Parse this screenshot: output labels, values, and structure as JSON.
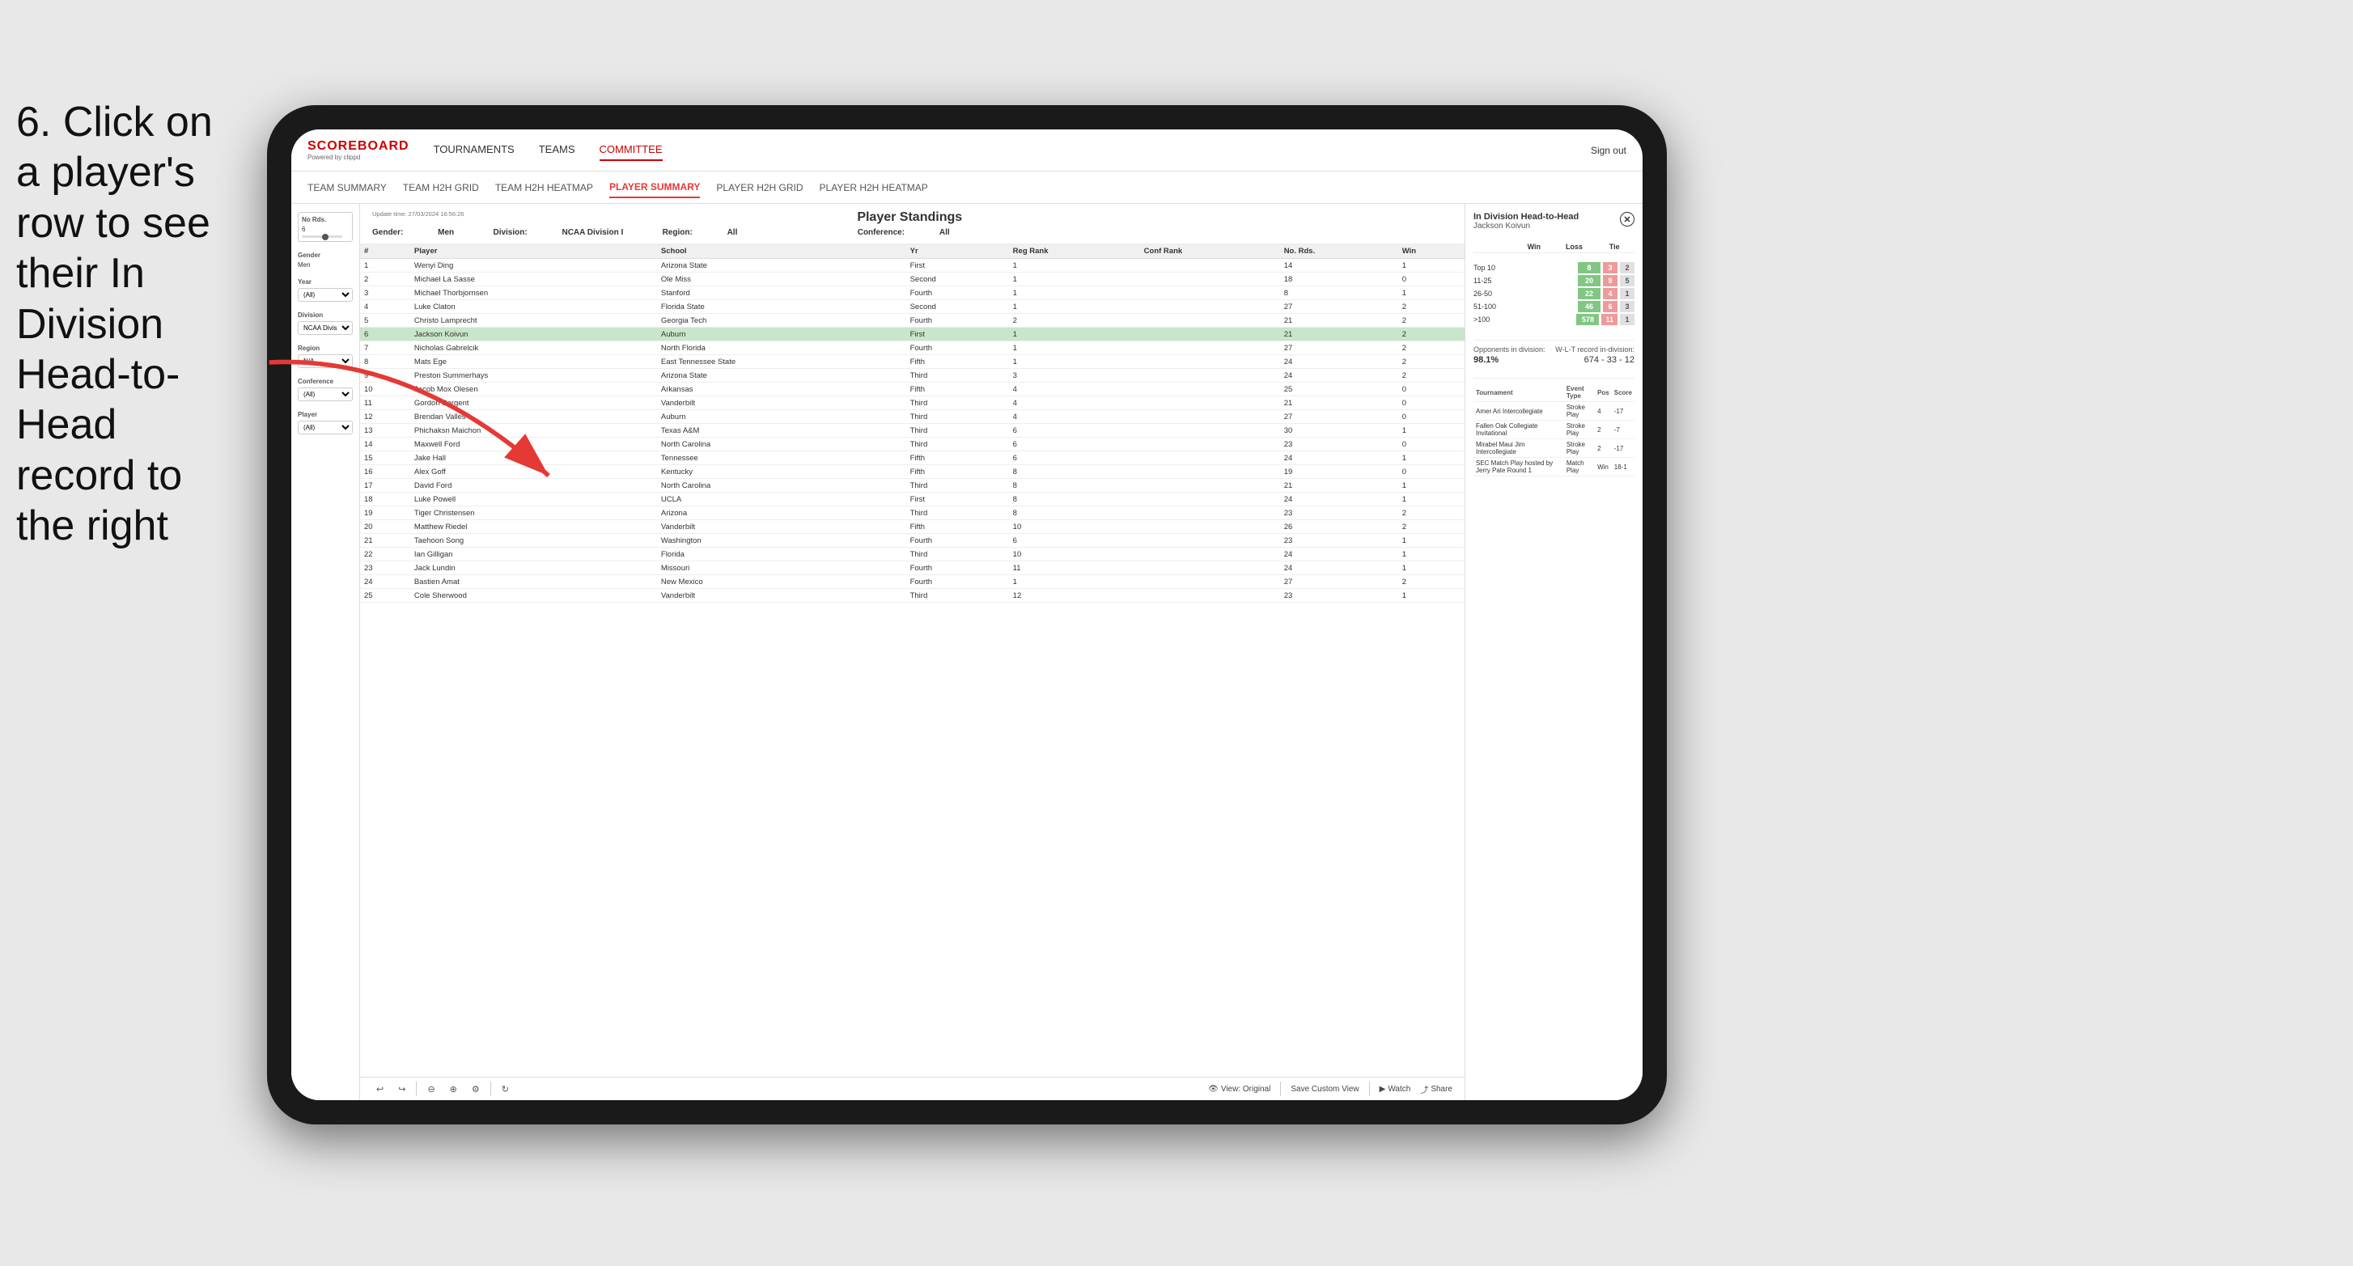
{
  "instruction": {
    "step": "6.",
    "text": "6. Click on a player's row to see their In Division Head-to-Head record to the right"
  },
  "nav": {
    "logo": "SCOREBOARD",
    "logo_sub": "Powered by clippd",
    "links": [
      "TOURNAMENTS",
      "TEAMS",
      "COMMITTEE"
    ],
    "sign_out": "Sign out"
  },
  "secondary_nav": {
    "links": [
      "TEAM SUMMARY",
      "TEAM H2H GRID",
      "TEAM H2H HEATMAP",
      "PLAYER SUMMARY",
      "PLAYER H2H GRID",
      "PLAYER H2H HEATMAP"
    ],
    "active": "PLAYER SUMMARY"
  },
  "filters": {
    "no_rds_label": "No Rds.",
    "no_rds_value": "6",
    "gender_label": "Gender",
    "gender_value": "Men",
    "year_label": "Year",
    "year_value": "(All)",
    "division_label": "Division",
    "division_value": "NCAA Division I",
    "region_label": "Region",
    "region_value": "N/A",
    "conference_label": "Conference",
    "conference_value": "(All)",
    "player_label": "Player",
    "player_value": "(All)"
  },
  "standings": {
    "update_time_label": "Update time:",
    "update_time": "27/03/2024 16:56:26",
    "title": "Player Standings",
    "gender_label": "Gender:",
    "gender_value": "Men",
    "division_label": "Division:",
    "division_value": "NCAA Division I",
    "region_label": "Region:",
    "region_value": "All",
    "conference_label": "Conference:",
    "conference_value": "All",
    "columns": [
      "#",
      "Player",
      "School",
      "Yr",
      "Reg Rank",
      "Conf Rank",
      "No. Rds.",
      "Win"
    ],
    "rows": [
      {
        "num": 1,
        "player": "Wenyi Ding",
        "school": "Arizona State",
        "yr": "First",
        "reg_rank": 1,
        "conf_rank": "",
        "no_rds": 14,
        "win": 1
      },
      {
        "num": 2,
        "player": "Michael La Sasse",
        "school": "Ole Miss",
        "yr": "Second",
        "reg_rank": 1,
        "conf_rank": "",
        "no_rds": 18,
        "win": 0
      },
      {
        "num": 3,
        "player": "Michael Thorbjornsen",
        "school": "Stanford",
        "yr": "Fourth",
        "reg_rank": 1,
        "conf_rank": "",
        "no_rds": 8,
        "win": 1
      },
      {
        "num": 4,
        "player": "Luke Claton",
        "school": "Florida State",
        "yr": "Second",
        "reg_rank": 1,
        "conf_rank": "",
        "no_rds": 27,
        "win": 2
      },
      {
        "num": 5,
        "player": "Christo Lamprecht",
        "school": "Georgia Tech",
        "yr": "Fourth",
        "reg_rank": 2,
        "conf_rank": "",
        "no_rds": 21,
        "win": 2
      },
      {
        "num": 6,
        "player": "Jackson Koivun",
        "school": "Auburn",
        "yr": "First",
        "reg_rank": 1,
        "conf_rank": "",
        "no_rds": 21,
        "win": 2,
        "selected": true
      },
      {
        "num": 7,
        "player": "Nicholas Gabrelcik",
        "school": "North Florida",
        "yr": "Fourth",
        "reg_rank": 1,
        "conf_rank": "",
        "no_rds": 27,
        "win": 2
      },
      {
        "num": 8,
        "player": "Mats Ege",
        "school": "East Tennessee State",
        "yr": "Fifth",
        "reg_rank": 1,
        "conf_rank": "",
        "no_rds": 24,
        "win": 2
      },
      {
        "num": 9,
        "player": "Preston Summerhays",
        "school": "Arizona State",
        "yr": "Third",
        "reg_rank": 3,
        "conf_rank": "",
        "no_rds": 24,
        "win": 2
      },
      {
        "num": 10,
        "player": "Jacob Mox Olesen",
        "school": "Arkansas",
        "yr": "Fifth",
        "reg_rank": 4,
        "conf_rank": "",
        "no_rds": 25,
        "win": 0
      },
      {
        "num": 11,
        "player": "Gordon Sargent",
        "school": "Vanderbilt",
        "yr": "Third",
        "reg_rank": 4,
        "conf_rank": "",
        "no_rds": 21,
        "win": 0
      },
      {
        "num": 12,
        "player": "Brendan Valles",
        "school": "Auburn",
        "yr": "Third",
        "reg_rank": 4,
        "conf_rank": "",
        "no_rds": 27,
        "win": 0
      },
      {
        "num": 13,
        "player": "Phichaksn Maichon",
        "school": "Texas A&M",
        "yr": "Third",
        "reg_rank": 6,
        "conf_rank": "",
        "no_rds": 30,
        "win": 1
      },
      {
        "num": 14,
        "player": "Maxwell Ford",
        "school": "North Carolina",
        "yr": "Third",
        "reg_rank": 6,
        "conf_rank": "",
        "no_rds": 23,
        "win": 0
      },
      {
        "num": 15,
        "player": "Jake Hall",
        "school": "Tennessee",
        "yr": "Fifth",
        "reg_rank": 6,
        "conf_rank": "",
        "no_rds": 24,
        "win": 1
      },
      {
        "num": 16,
        "player": "Alex Goff",
        "school": "Kentucky",
        "yr": "Fifth",
        "reg_rank": 8,
        "conf_rank": "",
        "no_rds": 19,
        "win": 0
      },
      {
        "num": 17,
        "player": "David Ford",
        "school": "North Carolina",
        "yr": "Third",
        "reg_rank": 8,
        "conf_rank": "",
        "no_rds": 21,
        "win": 1
      },
      {
        "num": 18,
        "player": "Luke Powell",
        "school": "UCLA",
        "yr": "First",
        "reg_rank": 8,
        "conf_rank": "",
        "no_rds": 24,
        "win": 1
      },
      {
        "num": 19,
        "player": "Tiger Christensen",
        "school": "Arizona",
        "yr": "Third",
        "reg_rank": 8,
        "conf_rank": "",
        "no_rds": 23,
        "win": 2
      },
      {
        "num": 20,
        "player": "Matthew Riedel",
        "school": "Vanderbilt",
        "yr": "Fifth",
        "reg_rank": 10,
        "conf_rank": "",
        "no_rds": 26,
        "win": 2
      },
      {
        "num": 21,
        "player": "Taehoon Song",
        "school": "Washington",
        "yr": "Fourth",
        "reg_rank": 6,
        "conf_rank": "",
        "no_rds": 23,
        "win": 1
      },
      {
        "num": 22,
        "player": "Ian Gilligan",
        "school": "Florida",
        "yr": "Third",
        "reg_rank": 10,
        "conf_rank": "",
        "no_rds": 24,
        "win": 1
      },
      {
        "num": 23,
        "player": "Jack Lundin",
        "school": "Missouri",
        "yr": "Fourth",
        "reg_rank": 11,
        "conf_rank": "",
        "no_rds": 24,
        "win": 1
      },
      {
        "num": 24,
        "player": "Bastien Amat",
        "school": "New Mexico",
        "yr": "Fourth",
        "reg_rank": 1,
        "conf_rank": "",
        "no_rds": 27,
        "win": 2
      },
      {
        "num": 25,
        "player": "Cole Sherwood",
        "school": "Vanderbilt",
        "yr": "Third",
        "reg_rank": 12,
        "conf_rank": "",
        "no_rds": 23,
        "win": 1
      }
    ]
  },
  "h2h_panel": {
    "title": "In Division Head-to-Head",
    "player": "Jackson Koivun",
    "col_win": "Win",
    "col_loss": "Loss",
    "col_tie": "Tie",
    "rows": [
      {
        "label": "Top 10",
        "win": 8,
        "loss": 3,
        "tie": 2
      },
      {
        "label": "11-25",
        "win": 20,
        "loss": 9,
        "tie": 5
      },
      {
        "label": "26-50",
        "win": 22,
        "loss": 4,
        "tie": 1
      },
      {
        "label": "51-100",
        "win": 46,
        "loss": 6,
        "tie": 3
      },
      {
        "label": ">100",
        "win": 578,
        "loss": 11,
        "tie": 1
      }
    ],
    "opponents_label": "Opponents in division:",
    "wlt_label": "W-L-T record in-division:",
    "opponents_pct": "98.1%",
    "wlt_record": "674 - 33 - 12",
    "tournament_columns": [
      "Tournament",
      "Event Type",
      "Pos",
      "Score"
    ],
    "tournaments": [
      {
        "name": "Amer Ari Intercollegiate",
        "type": "Stroke Play",
        "pos": 4,
        "score": "-17"
      },
      {
        "name": "Fallen Oak Collegiate Invitational",
        "type": "Stroke Play",
        "pos": 2,
        "score": "-7"
      },
      {
        "name": "Mirabel Maui Jim Intercollegiate",
        "type": "Stroke Play",
        "pos": 2,
        "score": "-17"
      },
      {
        "name": "SEC Match Play hosted by Jerry Pate Round 1",
        "type": "Match Play",
        "pos": "Win",
        "score": "18-1"
      }
    ]
  },
  "toolbar": {
    "view_original": "View: Original",
    "save_custom_view": "Save Custom View",
    "watch": "Watch",
    "share": "Share"
  }
}
